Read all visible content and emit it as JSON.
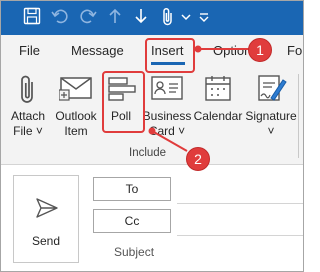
{
  "colors": {
    "titlebar": "#1a66b3",
    "annotation": "#e03c3c",
    "ribbon": "#f3f3f3"
  },
  "quick_access": [
    "save-icon",
    "undo-icon",
    "redo-icon",
    "up-arrow-icon",
    "down-arrow-icon",
    "attach-icon",
    "chevron-down-icon"
  ],
  "tabs": [
    {
      "label": "File"
    },
    {
      "label": "Message"
    },
    {
      "label": "Insert"
    },
    {
      "label": "Options"
    },
    {
      "label": "Fo"
    }
  ],
  "ribbon": {
    "buttons": [
      {
        "line1": "Attach",
        "line2": "File ˅",
        "icon": "paperclip-icon"
      },
      {
        "line1": "Outlook",
        "line2": "Item",
        "icon": "envelope-icon"
      },
      {
        "line1": "Poll",
        "line2": "",
        "icon": "poll-icon"
      },
      {
        "line1": "Business",
        "line2": "Card ˅",
        "icon": "business-card-icon"
      },
      {
        "line1": "Calendar",
        "line2": "",
        "icon": "calendar-icon"
      },
      {
        "line1": "Signature",
        "line2": "˅",
        "icon": "signature-icon"
      }
    ],
    "group_label": "Include"
  },
  "compose": {
    "send_label": "Send",
    "to_label": "To",
    "cc_label": "Cc",
    "subject_label": "Subject"
  },
  "annotations": [
    {
      "number": "1"
    },
    {
      "number": "2"
    }
  ]
}
